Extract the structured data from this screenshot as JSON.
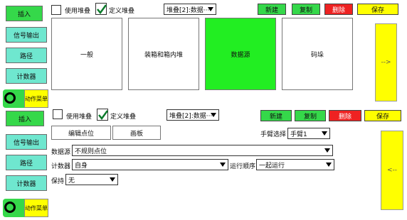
{
  "sidebar1": {
    "insert": "插入",
    "signal_out": "信号输出",
    "path": "路径",
    "counter": "计数器",
    "action_menu": "动作菜单"
  },
  "sidebar2": {
    "insert": "插入",
    "signal_out": "信号输出",
    "path": "路径",
    "counter": "计数器",
    "action_menu": "动作菜单"
  },
  "panel1": {
    "use_stack": "使用堆叠",
    "define_stack": "定义堆叠",
    "stack_select": "堆叠[2]:数据···",
    "new": "新建",
    "copy": "复制",
    "delete": "删除",
    "save": "保存",
    "tiles": [
      "一般",
      "装箱和箱内堆",
      "数据源",
      "码垛"
    ],
    "next_arrow": "-->"
  },
  "panel2": {
    "use_stack": "使用堆叠",
    "define_stack": "定义堆叠",
    "stack_select": "堆叠[2]:数据···",
    "new": "新建",
    "copy": "复制",
    "delete": "删除",
    "save": "保存",
    "edit_points": "编辑点位",
    "canvas": "画板",
    "arm_select_label": "手臂选择",
    "arm_select_value": "手臂1",
    "data_source_label": "数据源",
    "data_source_value": "不规则点位",
    "counter_label": "计数器",
    "counter_value": "自身",
    "run_order_label": "运行顺序",
    "run_order_value": "一起运行",
    "hold_label": "保持",
    "hold_value": "无",
    "back_arrow": "<--"
  },
  "colors": {
    "green": "#35d84a",
    "cyan": "#6fe7cf",
    "red": "#ee2222",
    "yellow": "#ffff00"
  }
}
